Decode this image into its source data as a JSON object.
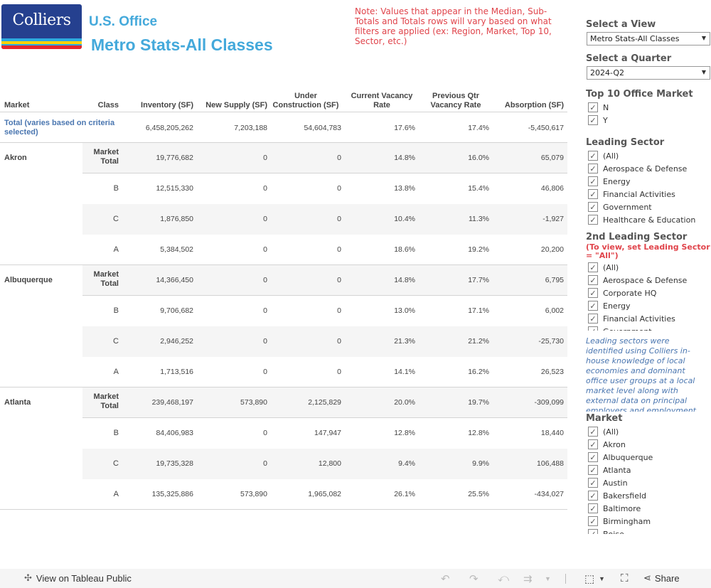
{
  "header": {
    "logo_text": "Colliers",
    "title_line1": "U.S. Office",
    "title_line2": "Metro Stats-All Classes",
    "note": "Note: Values that appear in the Median, Sub-Totals and Totals rows will vary based on what filters are applied (ex: Region, Market, Top 10, Sector, etc.)"
  },
  "colors": {
    "brand_blue": "#25408f",
    "title_blue": "#44a9db",
    "note_red": "#e0444b",
    "link_blue": "#4a76b0"
  },
  "table": {
    "columns": [
      "Market",
      "Class",
      "Inventory (SF)",
      "New Supply (SF)",
      "Under Construction (SF)",
      "Current Vacancy Rate",
      "Previous Qtr Vacancy Rate",
      "Absorption (SF)"
    ],
    "total": {
      "label": "Total (varies based on criteria selected)",
      "values": [
        "6,458,205,262",
        "7,203,188",
        "54,604,783",
        "17.6%",
        "17.4%",
        "-5,450,617"
      ]
    },
    "groups": [
      {
        "market": "Akron",
        "rows": [
          {
            "class": "Market Total",
            "values": [
              "19,776,682",
              "0",
              "0",
              "14.8%",
              "16.0%",
              "65,079"
            ]
          },
          {
            "class": "B",
            "values": [
              "12,515,330",
              "0",
              "0",
              "13.8%",
              "15.4%",
              "46,806"
            ]
          },
          {
            "class": "C",
            "values": [
              "1,876,850",
              "0",
              "0",
              "10.4%",
              "11.3%",
              "-1,927"
            ]
          },
          {
            "class": "A",
            "values": [
              "5,384,502",
              "0",
              "0",
              "18.6%",
              "19.2%",
              "20,200"
            ]
          }
        ]
      },
      {
        "market": "Albuquerque",
        "rows": [
          {
            "class": "Market Total",
            "values": [
              "14,366,450",
              "0",
              "0",
              "14.8%",
              "17.7%",
              "6,795"
            ]
          },
          {
            "class": "B",
            "values": [
              "9,706,682",
              "0",
              "0",
              "13.0%",
              "17.1%",
              "6,002"
            ]
          },
          {
            "class": "C",
            "values": [
              "2,946,252",
              "0",
              "0",
              "21.3%",
              "21.2%",
              "-25,730"
            ]
          },
          {
            "class": "A",
            "values": [
              "1,713,516",
              "0",
              "0",
              "14.1%",
              "16.2%",
              "26,523"
            ]
          }
        ]
      },
      {
        "market": "Atlanta",
        "rows": [
          {
            "class": "Market Total",
            "values": [
              "239,468,197",
              "573,890",
              "2,125,829",
              "20.0%",
              "19.7%",
              "-309,099"
            ]
          },
          {
            "class": "B",
            "values": [
              "84,406,983",
              "0",
              "147,947",
              "12.8%",
              "12.8%",
              "18,440"
            ]
          },
          {
            "class": "C",
            "values": [
              "19,735,328",
              "0",
              "12,800",
              "9.4%",
              "9.9%",
              "106,488"
            ]
          },
          {
            "class": "A",
            "values": [
              "135,325,886",
              "573,890",
              "1,965,082",
              "26.1%",
              "25.5%",
              "-434,027"
            ]
          }
        ]
      }
    ]
  },
  "sidebar": {
    "view": {
      "label": "Select a View",
      "value": "Metro Stats-All Classes"
    },
    "quarter": {
      "label": "Select a Quarter",
      "value": "2024-Q2"
    },
    "top10": {
      "label": "Top 10 Office Market",
      "items": [
        "N",
        "Y"
      ]
    },
    "leading_sector": {
      "label": "Leading Sector",
      "items": [
        "(All)",
        "Aerospace & Defense",
        "Energy",
        "Financial Activities",
        "Government",
        "Healthcare & Education"
      ]
    },
    "second_sector": {
      "label": "2nd Leading Sector",
      "warning": "(To view, set Leading Sector = \"All\")",
      "items": [
        "(All)",
        "Aerospace & Defense",
        "Corporate HQ",
        "Energy",
        "Financial Activities",
        "Government"
      ]
    },
    "info_text": "Leading sectors were identified using Colliers in-house knowledge of local economies and dominant office user groups at a local market level along with external data on principal employers and employment...",
    "market": {
      "label": "Market",
      "items": [
        "(All)",
        "Akron",
        "Albuquerque",
        "Atlanta",
        "Austin",
        "Bakersfield",
        "Baltimore",
        "Birmingham",
        "Boise"
      ]
    }
  },
  "footer": {
    "tableau_link": "View on Tableau Public",
    "share_label": "Share",
    "icons": [
      "undo-icon",
      "redo-icon",
      "revert-icon",
      "refresh-icon",
      "download-icon",
      "fullscreen-icon",
      "share-icon"
    ]
  }
}
